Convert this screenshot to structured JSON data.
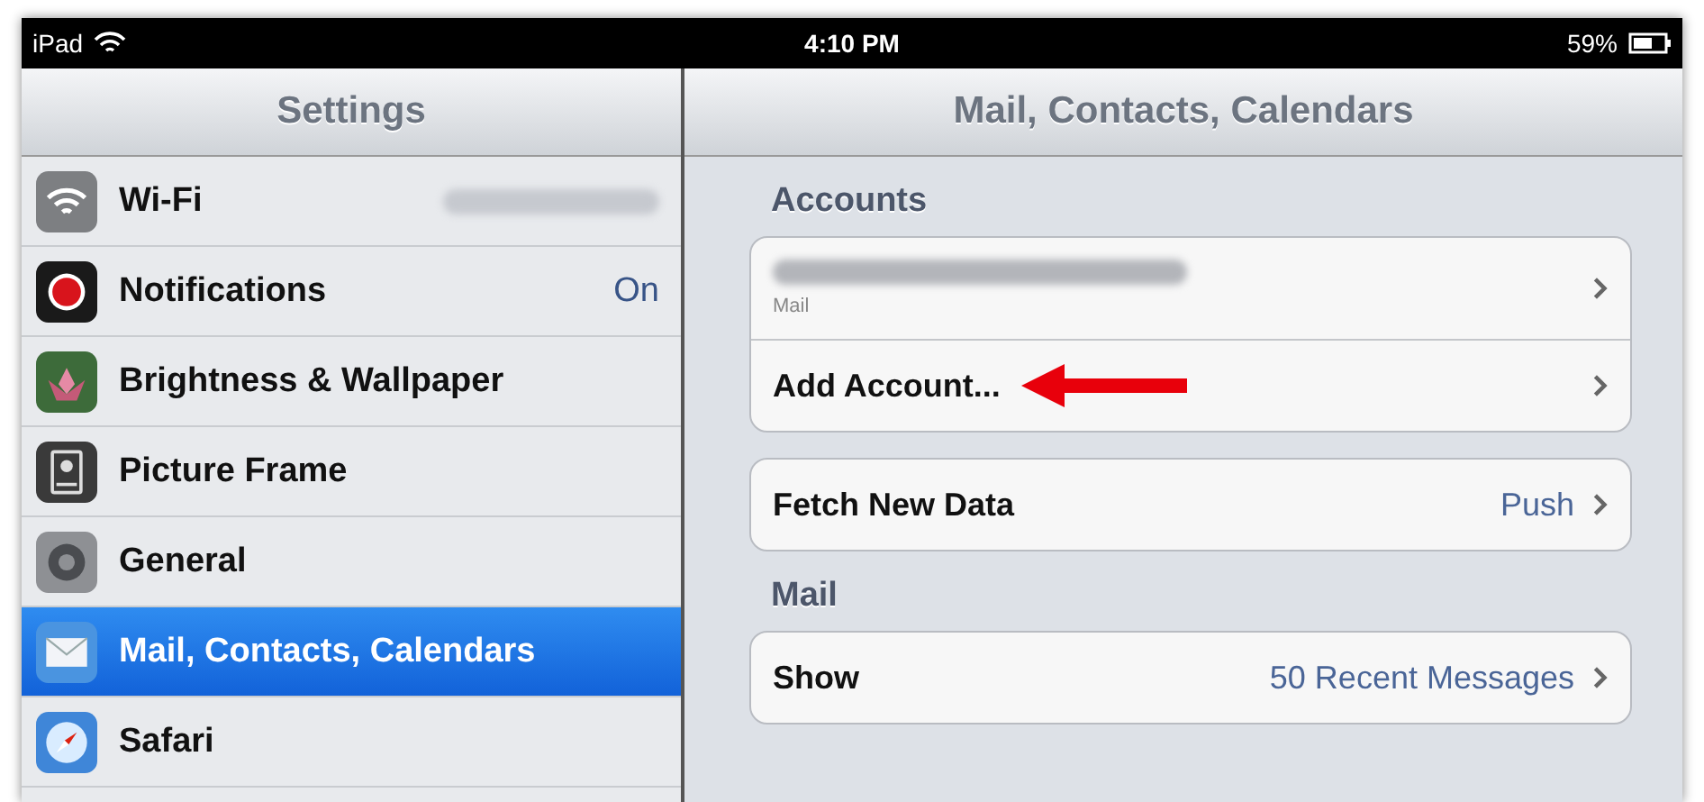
{
  "status_bar": {
    "device": "iPad",
    "time": "4:10 PM",
    "battery": "59%"
  },
  "sidebar": {
    "title": "Settings",
    "items": [
      {
        "kind": "wifi",
        "label": "Wi-Fi",
        "value_hidden": true,
        "selected": false
      },
      {
        "kind": "notifications",
        "label": "Notifications",
        "value": "On",
        "value_hidden": false,
        "selected": false
      },
      {
        "kind": "brightness",
        "label": "Brightness & Wallpaper",
        "value_hidden": false,
        "selected": false
      },
      {
        "kind": "picture-frame",
        "label": "Picture Frame",
        "value_hidden": false,
        "selected": false
      },
      {
        "kind": "general",
        "label": "General",
        "value_hidden": false,
        "selected": false
      },
      {
        "kind": "mail",
        "label": "Mail, Contacts, Calendars",
        "value_hidden": false,
        "selected": true
      },
      {
        "kind": "safari",
        "label": "Safari",
        "value_hidden": false,
        "selected": false
      }
    ]
  },
  "detail": {
    "title": "Mail, Contacts, Calendars",
    "sections": [
      {
        "header": "Accounts",
        "rows": [
          {
            "kind": "account",
            "subtitle": "Mail"
          },
          {
            "kind": "action",
            "label": "Add Account...",
            "pointer_arrow": true
          }
        ]
      },
      {
        "rows": [
          {
            "kind": "setting",
            "label": "Fetch New Data",
            "value": "Push"
          }
        ]
      },
      {
        "header": "Mail",
        "rows": [
          {
            "kind": "setting",
            "label": "Show",
            "value": "50 Recent Messages"
          }
        ]
      }
    ]
  }
}
